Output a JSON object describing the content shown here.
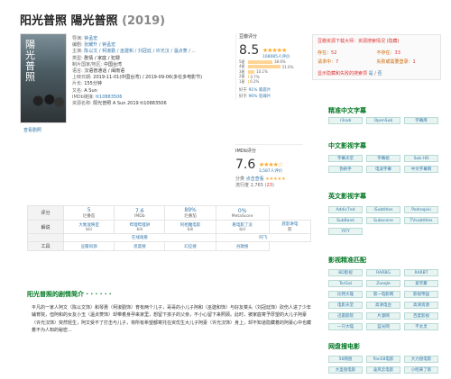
{
  "title": {
    "main": "阳光普照 陽光普照",
    "year": "(2019)"
  },
  "poster": {
    "text": "陽光普照",
    "caption": "查看剧照"
  },
  "info": [
    {
      "k": "导演:",
      "v": "钟孟宏"
    },
    {
      "k": "编剧:",
      "v": "张耀升 / 钟孟宏"
    },
    {
      "k": "主演:",
      "v": "陈以文 / 柯淑勤 / 巫建和 / 刘冠廷 / 许光汉 / 温贞菱 / ..."
    },
    {
      "k": "类型:",
      "p": "剧情 / 家庭 / 犯罪"
    },
    {
      "k": "制片国家/地区:",
      "p": "中国台湾"
    },
    {
      "k": "语言:",
      "p": "汉语普通话 / 闽南语"
    },
    {
      "k": "上映日期:",
      "p": "2019-11-01(中国台湾) / 2019-09-06(多伦多电影节)"
    },
    {
      "k": "片长:",
      "p": "155分钟"
    },
    {
      "k": "又名:",
      "p": "A Sun"
    },
    {
      "k": "IMDb链接:",
      "v": "tt10883506"
    },
    {
      "k": "资源名称:",
      "p": "阳光普照 A Sun 2019 tt10883506"
    }
  ],
  "douban": {
    "label": "豆瓣评分",
    "score": "8.5",
    "stars": "★★★★★",
    "count": "108085人评价",
    "bars": [
      {
        "label": "5星",
        "pct": "38.6%",
        "value": 38.6
      },
      {
        "label": "4星",
        "pct": "51.0%",
        "value": 51.0
      },
      {
        "label": "3星",
        "pct": "10.1%",
        "value": 10.1
      },
      {
        "label": "2星",
        "pct": "0.7%",
        "value": 0.7
      },
      {
        "label": "1星",
        "pct": "0.2%",
        "value": 0.2
      }
    ],
    "better1_pre": "好于",
    "better1_v": "91% 家庭片",
    "better2_pre": "好于",
    "better2_v": "96% 犯罪片"
  },
  "imdb": {
    "label": "IMDb评分",
    "score": "7.6",
    "stars": "★★★★☆",
    "count": "3,587人评价",
    "track_label": "分类",
    "track_link": "点击查看",
    "track_stars": "★★★★★",
    "trend_label": "流行度",
    "trend_value": "2,765",
    "trend_up": "23"
  },
  "sidebox": {
    "line1": "豆瓣资源下载大师：资源搜索情况",
    "line1b": "(隐藏)",
    "grid": [
      {
        "lbl": "存在：",
        "val": "52"
      },
      {
        "lbl": "不存在：",
        "val": "33"
      },
      {
        "lbl": "请求中：",
        "val": "7"
      },
      {
        "lbl": "失败或需要登录：",
        "val": "1"
      }
    ],
    "foot": "显示隐藏和失败的搜索项",
    "foot_v": "是",
    "foot_sep": "/",
    "foot_v2": "否"
  },
  "sections": {
    "s1": {
      "title": "精准中文字幕",
      "tags": [
        "r3sub",
        "OpenSub",
        "字幕库"
      ]
    },
    "s2": {
      "title": "中文影视字幕",
      "tags": [
        "字幕天堂",
        "字幕组",
        "Sub HD",
        "伪射手",
        "电波字幕",
        "中文字幕网"
      ]
    },
    "s3": {
      "title": "英文影视字幕",
      "tags": [
        "Addic7ed",
        "iSubtitles",
        "Podnapisi",
        "SubBank",
        "Subscene",
        "TVsubtitles",
        "YIFY"
      ]
    },
    "s4": {
      "title": "影视精准匹配",
      "tags": [
        "BD影视",
        "RARBG",
        "RARBT",
        "TorGal",
        "Zooqle",
        "爱笑聚",
        "比特大雄",
        "第一电影网",
        "影视帝国",
        "电影天堂",
        "高清电台",
        "高清资源",
        "迅雷影院",
        "片源网",
        "百度影视",
        "一只大喵",
        "蓝光网",
        "不太灵"
      ]
    },
    "s5": {
      "title": "网盘搜电影",
      "tags": [
        "56网盘",
        "Pan58电影",
        "大力盘电影",
        "大圣盘电影",
        "凌风云电影",
        "小昭来了影"
      ]
    }
  },
  "table": {
    "rows": [
      {
        "h": "评分",
        "cells": [
          {
            "n": "5",
            "t": "烂番茄"
          },
          {
            "n": "7.6",
            "t": "IMDb"
          },
          {
            "n": "89%",
            "t": "烂番茄"
          },
          {
            "n": "0%",
            "t": "MetaScore"
          }
        ]
      },
      {
        "h": "解说",
        "cells": [
          {
            "l": "大象放映室",
            "t": "bili"
          },
          {
            "l": "哔哩哔哩讲",
            "t": "bili"
          },
          {
            "l": "阿相魔电影",
            "t": "bili"
          },
          {
            "l": "看电影了没",
            "t": "bili"
          },
          {
            "l": "底影讲电",
            "t": "影"
          }
        ]
      },
      {
        "h": "",
        "cells": [
          {
            "l": "在线观看",
            "t": ""
          },
          {
            "l": "阿飞",
            "t": ""
          }
        ]
      },
      {
        "h": "工具",
        "cells": [
          {
            "l": "豆瓣同源",
            "t": ""
          },
          {
            "l": "思度搜",
            "t": ""
          },
          {
            "l": "幻应搜",
            "t": ""
          },
          {
            "l": "谷歌搜",
            "t": ""
          }
        ]
      }
    ]
  },
  "plot": {
    "title": "阳光普照的剧情简介 · · · · · ·",
    "text": "平凡的一家人阿文（陈以文饰）和琴惠（柯淑勤饰）育有两个儿子，哥哥的小儿子阿和（巫建和饰）与好友菜头（刘冠廷饰）砍伤人进了少年辅育院，但阿和的女友小玉（温贞菱饰）却带着身孕来家里，想留下孩子的父亲，不小心留下来照顾。此时，被家庭寄予厚望的大儿子阿豪（许光汉饰）突然轻生，阿文受不了打击与儿子，将所有希望都寄托在资优生大儿子阿豪（许光汉饰）身上，却不知道隐藏着的阿豪心中也藏着不为人知的秘密..."
  }
}
